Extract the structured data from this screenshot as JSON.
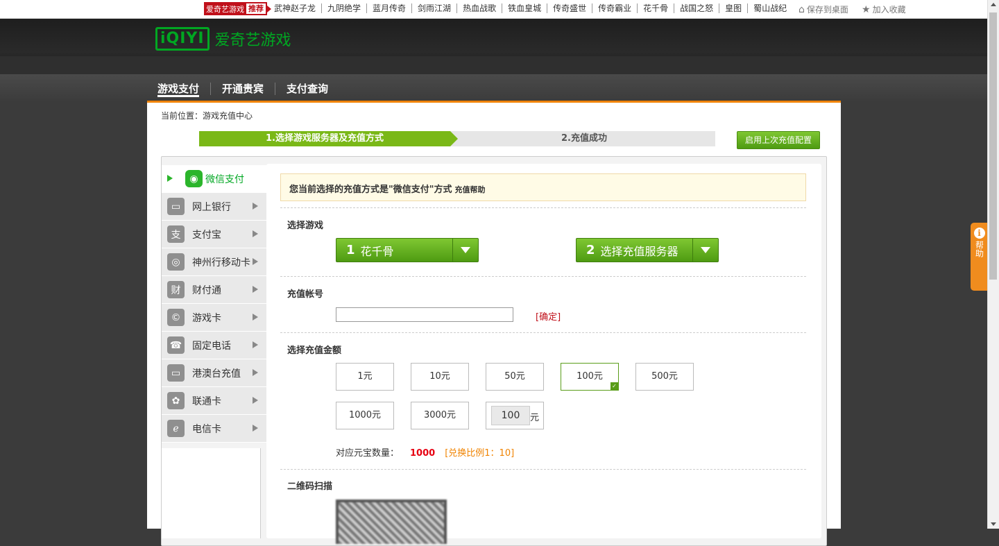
{
  "topbar": {
    "rec_label": "爱奇艺游戏",
    "rec_tag": "推荐",
    "links": [
      "武神赵子龙",
      "九阴绝学",
      "蓝月传奇",
      "剑雨江湖",
      "热血战歌",
      "铁血皇城",
      "传奇盛世",
      "传奇霸业",
      "花千骨",
      "战国之怒",
      "皇图",
      "蜀山战纪"
    ],
    "save_desktop": "保存到桌面",
    "add_favorite": "加入收藏"
  },
  "header": {
    "logo_mark": "iQIYI",
    "logo_text": "爱奇艺游戏"
  },
  "nav": {
    "items": [
      "游戏支付",
      "开通贵宾",
      "支付查询"
    ]
  },
  "breadcrumb": "当前位置：游戏充值中心",
  "steps": {
    "step1": "1.选择游戏服务器及充值方式",
    "step2": "2.充值成功"
  },
  "reuse_button": "启用上次充值配置",
  "sidebar": {
    "items": [
      {
        "label": "微信支付",
        "icon": "wechat-icon"
      },
      {
        "label": "网上银行",
        "icon": "bank-card-icon"
      },
      {
        "label": "支付宝",
        "icon": "alipay-icon"
      },
      {
        "label": "神州行移动卡",
        "icon": "china-mobile-icon"
      },
      {
        "label": "财付通",
        "icon": "tenpay-icon"
      },
      {
        "label": "游戏卡",
        "icon": "game-card-icon"
      },
      {
        "label": "固定电话",
        "icon": "telephone-icon"
      },
      {
        "label": "港澳台充值",
        "icon": "card-icon"
      },
      {
        "label": "联通卡",
        "icon": "china-unicom-icon"
      },
      {
        "label": "电信卡",
        "icon": "china-telecom-icon"
      }
    ]
  },
  "notice": {
    "text": "您当前选择的充值方式是\"微信支付\"方式",
    "help": "充值帮助"
  },
  "game_section": {
    "title": "选择游戏",
    "game_num": "1",
    "game_name": "花千骨",
    "server_num": "2",
    "server_name": "选择充值服务器"
  },
  "account_section": {
    "title": "充值帐号",
    "value": "",
    "confirm": "[确定]"
  },
  "amount_section": {
    "title": "选择充值金额",
    "options": [
      "1元",
      "10元",
      "50元",
      "100元",
      "500元",
      "1000元",
      "3000元"
    ],
    "selected": "100元",
    "custom_value": "100",
    "custom_unit": "元",
    "yuanbao_label": "对应元宝数量：",
    "yuanbao_value": "1000",
    "ratio": "[兑换比例1：10]"
  },
  "qr_section": {
    "title": "二维码扫描"
  },
  "help_tab": {
    "icon": "info-icon",
    "text": "帮助"
  },
  "colors": {
    "brand_green": "#00a722",
    "accent_orange": "#f08300",
    "button_green": "#5a9d1a",
    "red": "#e60012"
  }
}
